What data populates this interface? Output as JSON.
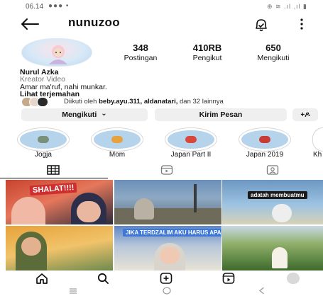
{
  "status_bar": {
    "time": "06.14",
    "left_icons": "●●● •",
    "right_icons": "⊕ ≋ .ıl .ıl ▮"
  },
  "header": {
    "username": "nunuzoo",
    "icons": [
      "back-arrow-icon",
      "bell-icon",
      "more-vertical-icon"
    ]
  },
  "stats": [
    {
      "value": "348",
      "label": "Postingan"
    },
    {
      "value": "410RB",
      "label": "Pengikut"
    },
    {
      "value": "650",
      "label": "Mengikuti"
    }
  ],
  "bio": {
    "name": "Nurul Azka",
    "category": "Kreator Video",
    "text": "Amar ma'ruf, nahi munkar.",
    "translate": "Lihat terjemahan"
  },
  "followed_by": {
    "prefix": "Diikuti oleh ",
    "users": "beby.ayu.311, aldanatari,",
    "suffix": " dan 32 lainnya"
  },
  "actions": {
    "following": "Mengikuti",
    "following_caret": "⌄",
    "message": "Kirim Pesan",
    "add_person": "+ዶ"
  },
  "highlights": [
    {
      "label": "Jogja"
    },
    {
      "label": "Mom"
    },
    {
      "label": "Japan Part II"
    },
    {
      "label": "Japan 2019"
    },
    {
      "label": "Kh"
    }
  ],
  "tabs": [
    "grid-icon",
    "reels-icon",
    "tagged-icon"
  ],
  "posts": [
    {
      "caption": "SHALAT!!!!"
    },
    {
      "caption": ""
    },
    {
      "caption": "adatah membuatmu"
    },
    {
      "caption": ""
    },
    {
      "caption": "JIKA TERDZALIM AKU HARUS APA?"
    },
    {
      "caption": ""
    }
  ],
  "bottom_nav": [
    "home-icon",
    "search-icon",
    "add-post-icon",
    "reels-icon",
    "profile-avatar"
  ],
  "system_nav": [
    "recents-icon",
    "home-circle-icon",
    "back-chevron-icon"
  ],
  "colors": {
    "accent_blue": "#3b6fd8",
    "highlight_bg": "#b6d3ec",
    "button_bg": "#efefef"
  }
}
